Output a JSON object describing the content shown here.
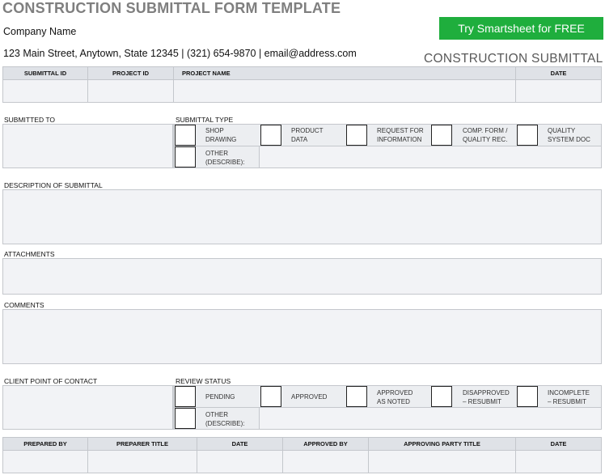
{
  "header": {
    "title": "CONSTRUCTION SUBMITTAL FORM TEMPLATE",
    "company": "Company Name",
    "address": "123 Main Street, Anytown, State 12345 | (321) 654-9870 | email@address.com",
    "cta_label": "Try Smartsheet for FREE",
    "subtitle": "CONSTRUCTION SUBMITTAL"
  },
  "top_table": {
    "headers": [
      "SUBMITTAL ID",
      "PROJECT ID",
      "PROJECT NAME",
      "DATE"
    ]
  },
  "submitted_to": {
    "label": "SUBMITTED TO"
  },
  "submittal_type": {
    "label": "SUBMITTAL TYPE",
    "options": [
      "SHOP\nDRAWING",
      "PRODUCT\nDATA",
      "REQUEST FOR\nINFORMATION",
      "COMP. FORM /\nQUALITY REC.",
      "QUALITY\nSYSTEM DOC"
    ],
    "other": "OTHER\n(DESCRIBE):"
  },
  "description": {
    "label": "DESCRIPTION OF SUBMITTAL"
  },
  "attachments": {
    "label": "ATTACHMENTS"
  },
  "comments": {
    "label": "COMMENTS"
  },
  "client_contact": {
    "label": "CLIENT POINT OF CONTACT"
  },
  "review_status": {
    "label": "REVIEW STATUS",
    "options": [
      "PENDING",
      "APPROVED",
      "APPROVED\nAS NOTED",
      "DISAPPROVED\n– RESUBMIT",
      "INCOMPLETE\n– RESUBMIT"
    ],
    "other": "OTHER\n(DESCRIBE):"
  },
  "bottom_table": {
    "headers": [
      "PREPARED BY",
      "PREPARER TITLE",
      "DATE",
      "APPROVED BY",
      "APPROVING PARTY TITLE",
      "DATE"
    ]
  }
}
